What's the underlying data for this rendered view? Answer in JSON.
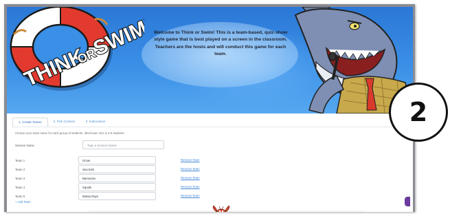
{
  "hero": {
    "logo_text_1": "THINK",
    "logo_text_2": "OR",
    "logo_text_3": "SWIM!",
    "welcome_message": "Welcome to Think or Swim! This is a team-based, quiz-show style game that is best played on a screen in the classroom. Teachers are the hosts and will conduct this game for each team."
  },
  "tabs": [
    {
      "label": "1. Create Teams",
      "active": true
    },
    {
      "label": "2. Pick Content",
      "active": false
    },
    {
      "label": "3. Instructions",
      "active": false
    }
  ],
  "form": {
    "hint": "Choose your team name for each group of students. Ideal team size is 3-5 students.",
    "session_label": "Session Name",
    "session_placeholder": "Type a Session Name",
    "teams": [
      {
        "label": "Team 1",
        "value": "Orcas",
        "remove": "Remove Team"
      },
      {
        "label": "Team 2",
        "value": "Sea Eels",
        "remove": "Remove Team"
      },
      {
        "label": "Team 3",
        "value": "Barnacles",
        "remove": "Remove Team"
      },
      {
        "label": "Team 4",
        "value": "Squids",
        "remove": "Remove Team"
      },
      {
        "label": "Team 5",
        "value": "Manta Rays",
        "remove": "Remove Team"
      }
    ],
    "add_team": "+ Add Team"
  },
  "badge": {
    "number": "2"
  },
  "colors": {
    "sky": "#3a8fe6",
    "link": "#3d86d6",
    "ring_red": "#e23a2e"
  }
}
